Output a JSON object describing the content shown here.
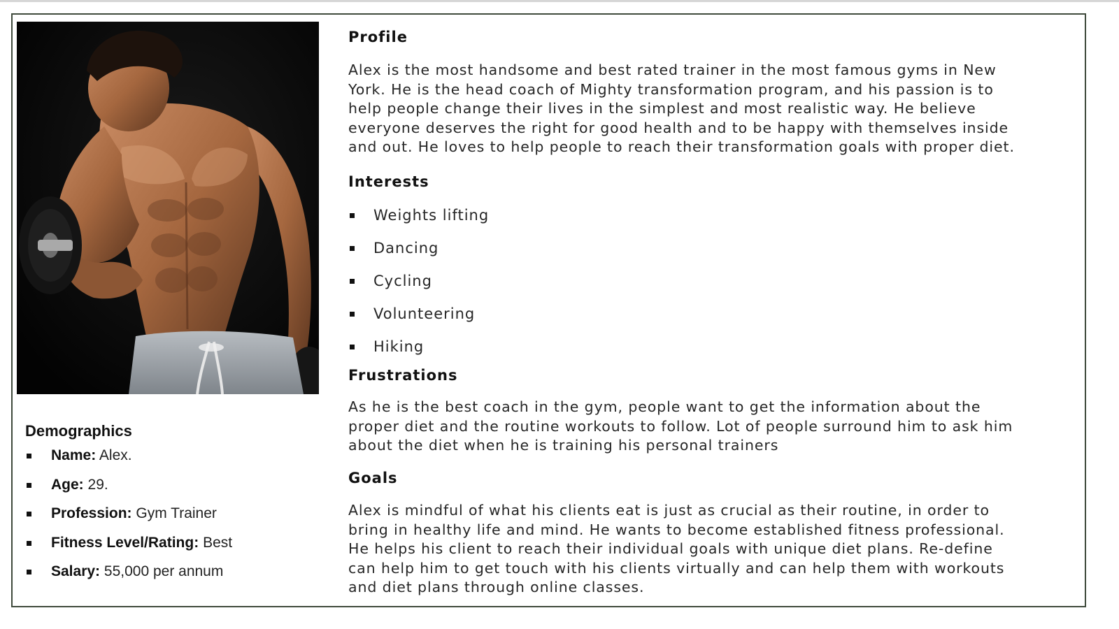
{
  "photo": {
    "icon": "trainer-photo"
  },
  "demographics": {
    "title": "Demographics",
    "items": [
      {
        "label": "Name:",
        "value": "Alex."
      },
      {
        "label": "Age:",
        "value": "29."
      },
      {
        "label": "Profession:",
        "value": "Gym Trainer"
      },
      {
        "label": "Fitness Level/Rating:",
        "value": "Best"
      },
      {
        "label": "Salary:",
        "value": "55,000 per annum"
      }
    ]
  },
  "profile": {
    "title": "Profile",
    "text": "Alex is the most handsome  and best rated trainer in the most famous gyms in New\nYork. He is the head coach of Mighty transformation program, and his passion is to\nhelp people change their lives in the simplest and most realistic way. He believe\neveryone deserves the right for good health and to be happy with themselves inside\nand out. He loves to help people to reach their transformation goals with proper diet."
  },
  "interests": {
    "title": "Interests",
    "items": [
      "Weights lifting",
      "Dancing",
      "Cycling",
      "Volunteering",
      "Hiking"
    ]
  },
  "frustrations": {
    "title": "Frustrations",
    "text": "As he is the best coach in the gym, people want to get the information about the\nproper diet and the routine workouts to follow. Lot of people surround him to ask him\nabout the diet when he is training his personal trainers"
  },
  "goals": {
    "title": "Goals",
    "text": "Alex is mindful of what his clients eat is just as crucial as their routine, in order to\nbring in healthy life and mind. He wants to become established fitness professional.\nHe helps his client to reach their individual goals with unique diet plans. Re-define\ncan help him to get touch with his clients virtually and can help them with  workouts\nand diet plans through online classes."
  }
}
